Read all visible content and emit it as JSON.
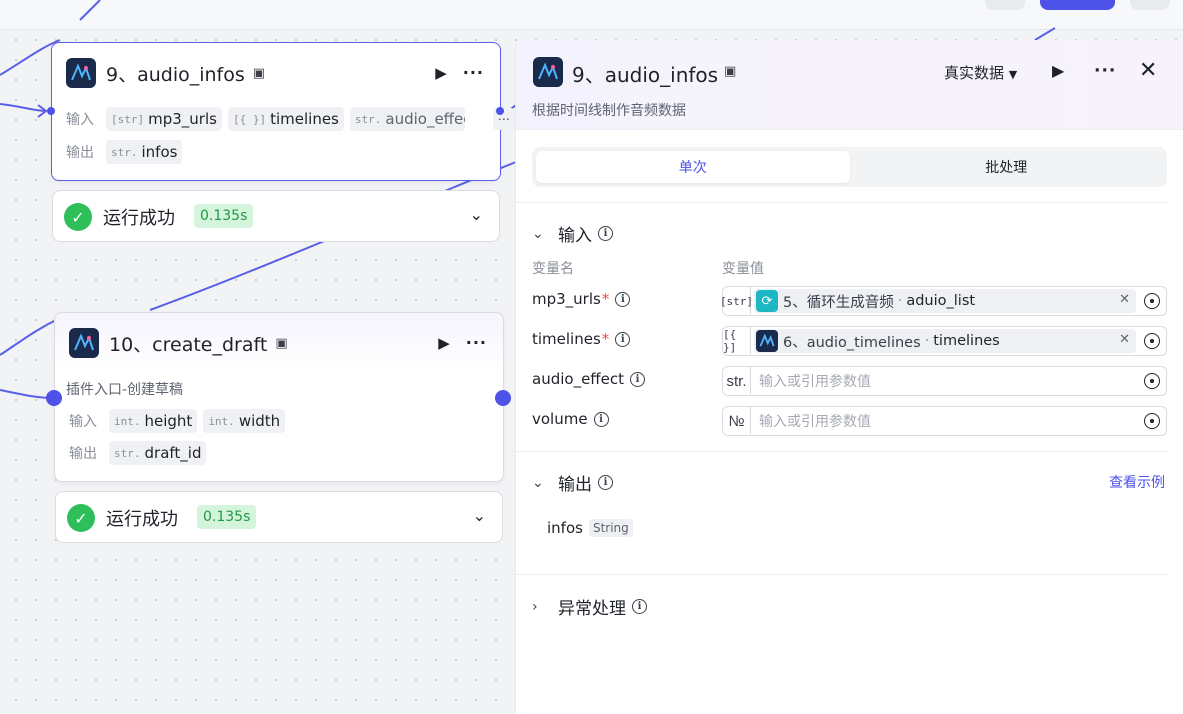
{
  "canvas": {
    "node_audio_infos": {
      "title": "9、audio_infos",
      "input_label": "输入",
      "output_label": "输出",
      "inputs": [
        {
          "type": "[str]",
          "name": "mp3_urls"
        },
        {
          "type": "[{ }]",
          "name": "timelines"
        },
        {
          "type": "str.",
          "name": "audio_effect"
        }
      ],
      "more": "⋯",
      "outputs": [
        {
          "type": "str.",
          "name": "infos"
        }
      ]
    },
    "status_1": {
      "text": "运行成功",
      "time": "0.135s"
    },
    "node_create_draft": {
      "title": "10、create_draft",
      "description": "插件入口-创建草稿",
      "input_label": "输入",
      "output_label": "输出",
      "inputs": [
        {
          "type": "int.",
          "name": "height"
        },
        {
          "type": "int.",
          "name": "width"
        }
      ],
      "outputs": [
        {
          "type": "str.",
          "name": "draft_id"
        }
      ]
    },
    "status_2": {
      "text": "运行成功",
      "time": "0.135s"
    }
  },
  "panel": {
    "title": "9、audio_infos",
    "description": "根据时间线制作音频数据",
    "realdata_label": "真实数据",
    "tabs": [
      {
        "label": "单次",
        "active": true
      },
      {
        "label": "批处理",
        "active": false
      }
    ],
    "input_section": {
      "title": "输入",
      "col_name": "变量名",
      "col_value": "变量值",
      "params": [
        {
          "name": "mp3_urls",
          "required": "*",
          "type": "[str]",
          "ref_node": "5、循环生成音频",
          "ref_var": "aduio_list"
        },
        {
          "name": "timelines",
          "required": "*",
          "type": "[{ }]",
          "ref_node": "6、audio_timelines",
          "ref_var": "timelines"
        },
        {
          "name": "audio_effect",
          "required": "",
          "type": "str.",
          "placeholder": "输入或引用参数值"
        },
        {
          "name": "volume",
          "required": "",
          "type": "№",
          "placeholder": "输入或引用参数值"
        }
      ]
    },
    "output_section": {
      "title": "输出",
      "example_link": "查看示例",
      "items": [
        {
          "name": "infos",
          "type": "String"
        }
      ]
    },
    "error_section": {
      "title": "异常处理"
    }
  },
  "colors": {
    "accent": "#4d53e8",
    "success": "#2fbf5a",
    "required": "#f54a45"
  },
  "icons": [
    "play-icon",
    "more-icon",
    "close-icon",
    "chevron-down-icon",
    "info-icon",
    "target-icon",
    "check-icon",
    "library-icon",
    "loop-icon"
  ]
}
